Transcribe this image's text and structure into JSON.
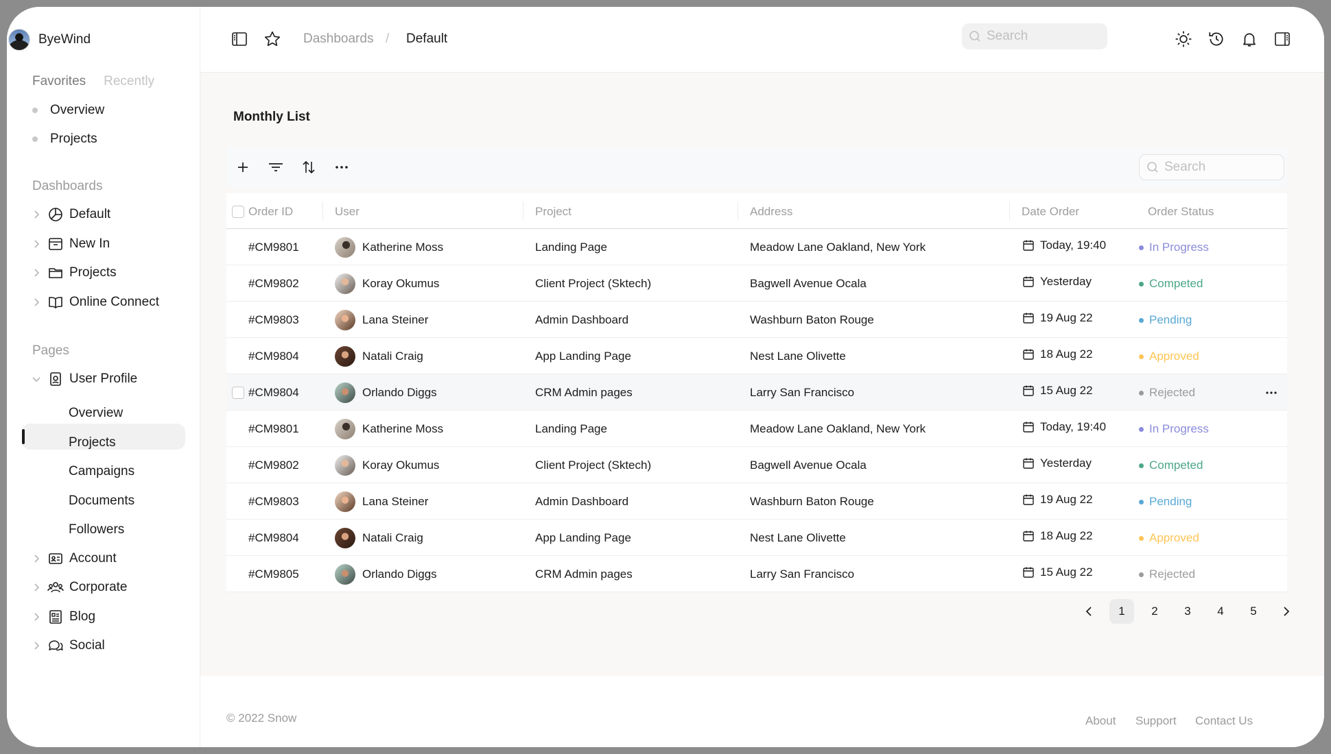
{
  "brand": {
    "name": "ByeWind"
  },
  "sidebar": {
    "tabs": [
      "Favorites",
      "Recently"
    ],
    "favorites": [
      "Overview",
      "Projects"
    ],
    "dashboards_title": "Dashboards",
    "dashboards": [
      {
        "label": "Default",
        "icon": "pie-chart-icon"
      },
      {
        "label": "New In",
        "icon": "archive-box-icon"
      },
      {
        "label": "Projects",
        "icon": "folder-icon"
      },
      {
        "label": "Online Connect",
        "icon": "book-open-icon"
      }
    ],
    "pages_title": "Pages",
    "user_profile": {
      "label": "User Profile",
      "icon": "id-badge-icon",
      "children": [
        "Overview",
        "Projects",
        "Campaigns",
        "Documents",
        "Followers"
      ]
    },
    "pages": [
      {
        "label": "Account",
        "icon": "id-card-icon"
      },
      {
        "label": "Corporate",
        "icon": "users-icon"
      },
      {
        "label": "Blog",
        "icon": "newspaper-icon"
      },
      {
        "label": "Social",
        "icon": "chat-bubbles-icon"
      }
    ]
  },
  "topbar": {
    "breadcrumb": [
      "Dashboards",
      "/",
      "Default"
    ],
    "search_placeholder": "Search"
  },
  "main": {
    "title": "Monthly List",
    "table_search_placeholder": "Search",
    "columns": [
      "Order ID",
      "User",
      "Project",
      "Address",
      "Date Order",
      "Order Status"
    ],
    "rows": [
      {
        "id": "#CM9801",
        "user": "Katherine Moss",
        "project": "Landing Page",
        "address": "Meadow Lane Oakland, New York",
        "date": "Today, 19:40",
        "status": "In Progress"
      },
      {
        "id": "#CM9802",
        "user": "Koray Okumus",
        "project": "Client Project (Sktech)",
        "address": "Bagwell Avenue Ocala",
        "date": "Yesterday",
        "status": "Competed"
      },
      {
        "id": "#CM9803",
        "user": "Lana Steiner",
        "project": "Admin Dashboard",
        "address": "Washburn Baton Rouge",
        "date": "19 Aug 22",
        "status": "Pending"
      },
      {
        "id": "#CM9804",
        "user": "Natali Craig",
        "project": "App Landing Page",
        "address": "Nest Lane Olivette",
        "date": "18 Aug 22",
        "status": "Approved"
      },
      {
        "id": "#CM9804",
        "user": "Orlando Diggs",
        "project": "CRM Admin pages",
        "address": "Larry San Francisco",
        "date": "15 Aug 22",
        "status": "Rejected"
      },
      {
        "id": "#CM9801",
        "user": "Katherine Moss",
        "project": "Landing Page",
        "address": "Meadow Lane Oakland, New York",
        "date": "Today, 19:40",
        "status": "In Progress"
      },
      {
        "id": "#CM9802",
        "user": "Koray Okumus",
        "project": "Client Project (Sktech)",
        "address": "Bagwell Avenue Ocala",
        "date": "Yesterday",
        "status": "Competed"
      },
      {
        "id": "#CM9803",
        "user": "Lana Steiner",
        "project": "Admin Dashboard",
        "address": "Washburn Baton Rouge",
        "date": "19 Aug 22",
        "status": "Pending"
      },
      {
        "id": "#CM9804",
        "user": "Natali Craig",
        "project": "App Landing Page",
        "address": "Nest Lane Olivette",
        "date": "18 Aug 22",
        "status": "Approved"
      },
      {
        "id": "#CM9805",
        "user": "Orlando Diggs",
        "project": "CRM Admin pages",
        "address": "Larry San Francisco",
        "date": "15 Aug 22",
        "status": "Rejected"
      }
    ],
    "status_colors": {
      "In Progress": "#8a8cd9",
      "Competed": "#4aa785",
      "Pending": "#59a8d4",
      "Approved": "#ffc555",
      "Rejected": "#9b9b9b"
    },
    "pagination": {
      "pages": [
        "1",
        "2",
        "3",
        "4",
        "5"
      ],
      "current": "1"
    }
  },
  "footer": {
    "copyright": "© 2022 Snow",
    "links": [
      "About",
      "Support",
      "Contact Us"
    ]
  }
}
